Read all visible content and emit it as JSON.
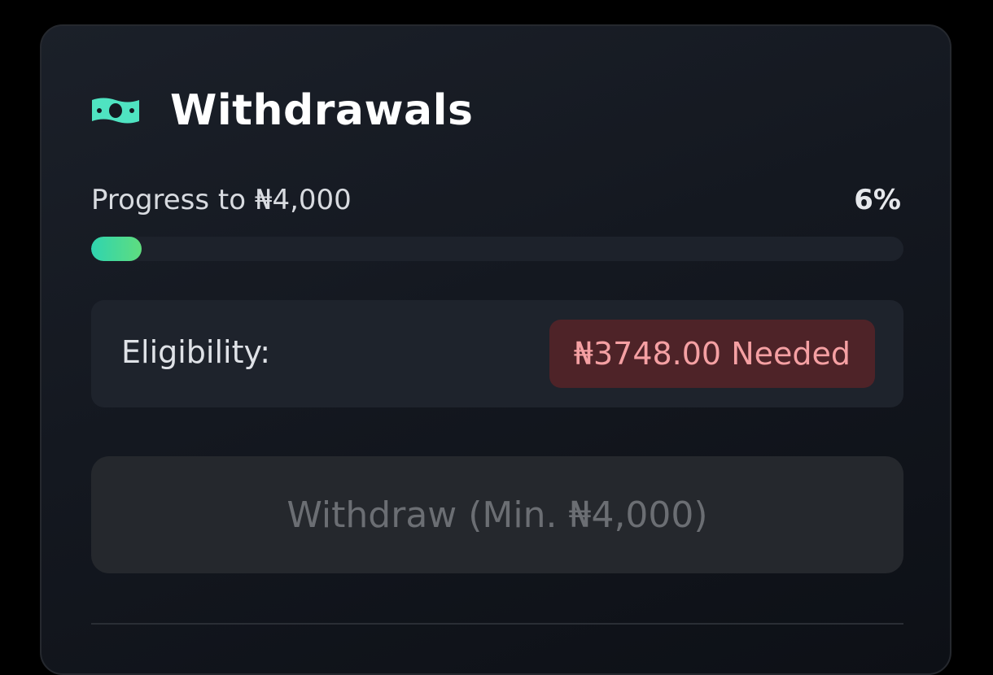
{
  "withdrawals": {
    "title": "Withdrawals",
    "icon": "cash-icon",
    "accent_color": "#4fe3c1",
    "progress": {
      "label": "Progress to ₦4,000",
      "percent_text": "6%",
      "fraction": 0.0625
    },
    "eligibility": {
      "label": "Eligibility:",
      "status": "₦3748.00 Needed",
      "status_color": "#f5a0a3"
    },
    "withdraw_button": {
      "label": "Withdraw (Min. ₦4,000)",
      "disabled": true
    }
  }
}
